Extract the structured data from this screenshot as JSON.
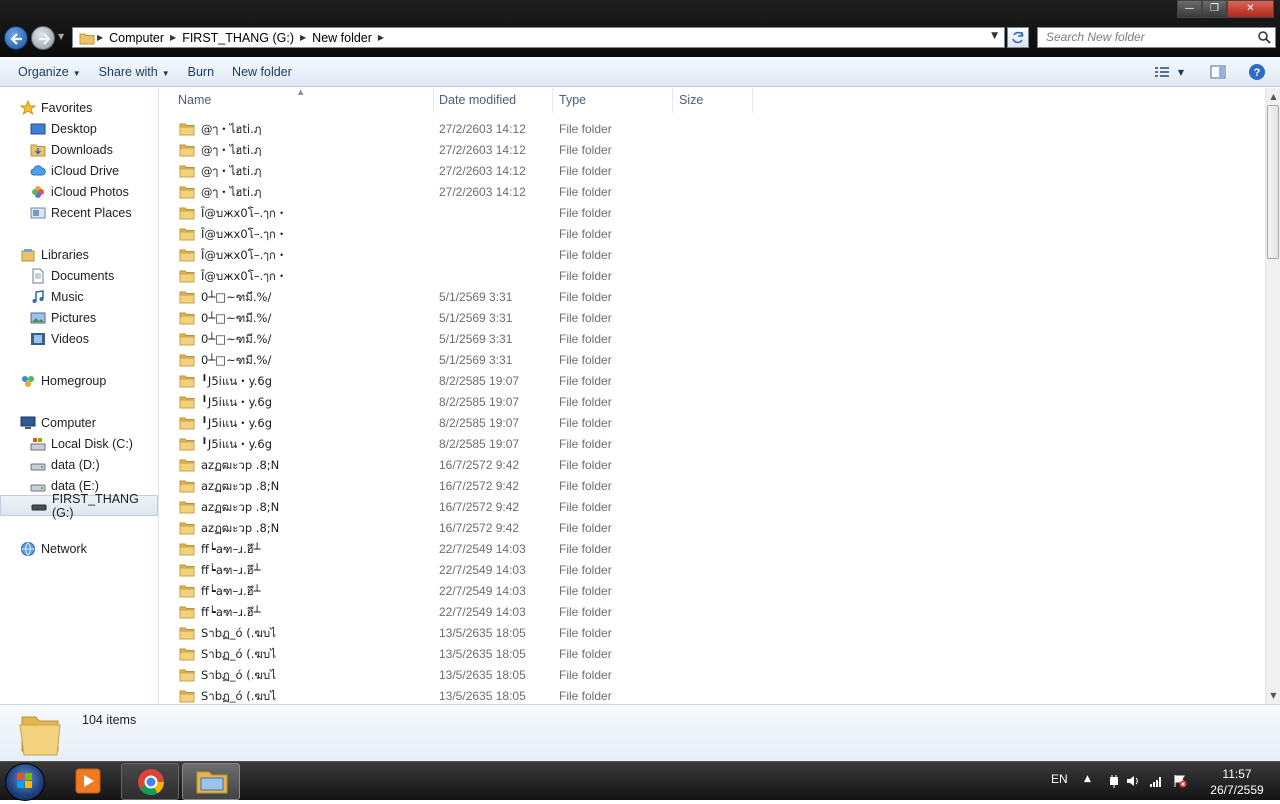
{
  "window": {
    "min_label": "—",
    "max_label": "❐",
    "close_label": "✕"
  },
  "address": {
    "crumbs": [
      "Computer",
      "FIRST_THANG (G:)",
      "New folder"
    ],
    "search_placeholder": "Search New folder"
  },
  "toolbar": {
    "organize": "Organize",
    "share_with": "Share with",
    "burn": "Burn",
    "new_folder": "New folder"
  },
  "nav": {
    "favorites": "Favorites",
    "desktop": "Desktop",
    "downloads": "Downloads",
    "icloud_drive": "iCloud Drive",
    "icloud_photos": "iCloud Photos",
    "recent_places": "Recent Places",
    "libraries": "Libraries",
    "documents": "Documents",
    "music": "Music",
    "pictures": "Pictures",
    "videos": "Videos",
    "homegroup": "Homegroup",
    "computer": "Computer",
    "local_disk": "Local Disk (C:)",
    "data_d": "data (D:)",
    "data_e": "data (E:)",
    "first_thang": "FIRST_THANG (G:)",
    "network": "Network"
  },
  "columns": {
    "name": "Name",
    "date": "Date modified",
    "type": "Type",
    "size": "Size"
  },
  "files": [
    {
      "name": "@ๅ・ไฮti.ฦ",
      "date": "27/2/2603 14:12",
      "type": "File folder",
      "size": ""
    },
    {
      "name": "@ๅ・ไฮti.ฦ",
      "date": "27/2/2603 14:12",
      "type": "File folder",
      "size": ""
    },
    {
      "name": "@ๅ・ไฮti.ฦ",
      "date": "27/2/2603 14:12",
      "type": "File folder",
      "size": ""
    },
    {
      "name": "@ๅ・ไฮti.ฦ",
      "date": "27/2/2603 14:12",
      "type": "File folder",
      "size": ""
    },
    {
      "name": "Ȋ@บжx0โ–.ๅก・",
      "date": "",
      "type": "File folder",
      "size": ""
    },
    {
      "name": "Ȋ@บжx0โ–.ๅก・",
      "date": "",
      "type": "File folder",
      "size": ""
    },
    {
      "name": "Ȋ@บжx0โ–.ๅก・",
      "date": "",
      "type": "File folder",
      "size": ""
    },
    {
      "name": "Ȋ@บжx0โ–.ๅก・",
      "date": "",
      "type": "File folder",
      "size": ""
    },
    {
      "name": "0┴□~ฑมี.%/",
      "date": "5/1/2569 3:31",
      "type": "File folder",
      "size": ""
    },
    {
      "name": "0┴□~ฑมี.%/",
      "date": "5/1/2569 3:31",
      "type": "File folder",
      "size": ""
    },
    {
      "name": "0┴□~ฑมี.%/",
      "date": "5/1/2569 3:31",
      "type": "File folder",
      "size": ""
    },
    {
      "name": "0┴□~ฑมี.%/",
      "date": "5/1/2569 3:31",
      "type": "File folder",
      "size": ""
    },
    {
      "name": "╹J5iแน・y.6g",
      "date": "8/2/2585 19:07",
      "type": "File folder",
      "size": ""
    },
    {
      "name": "╹J5iแน・y.6g",
      "date": "8/2/2585 19:07",
      "type": "File folder",
      "size": ""
    },
    {
      "name": "╹J5iแน・y.6g",
      "date": "8/2/2585 19:07",
      "type": "File folder",
      "size": ""
    },
    {
      "name": "╹J5iแน・y.6g",
      "date": "8/2/2585 19:07",
      "type": "File folder",
      "size": ""
    },
    {
      "name": "azฏฒะวp .8;N",
      "date": "16/7/2572 9:42",
      "type": "File folder",
      "size": ""
    },
    {
      "name": "azฏฒะวp .8;N",
      "date": "16/7/2572 9:42",
      "type": "File folder",
      "size": ""
    },
    {
      "name": "azฏฒะวp .8;N",
      "date": "16/7/2572 9:42",
      "type": "File folder",
      "size": ""
    },
    {
      "name": "azฏฒะวp .8;N",
      "date": "16/7/2572 9:42",
      "type": "File folder",
      "size": ""
    },
    {
      "name": "ff┕aฑ–ɹ.ฮึ┴",
      "date": "22/7/2549 14:03",
      "type": "File folder",
      "size": ""
    },
    {
      "name": "ff┕aฑ–ɹ.ฮึ┴",
      "date": "22/7/2549 14:03",
      "type": "File folder",
      "size": ""
    },
    {
      "name": "ff┕aฑ–ɹ.ฮึ┴",
      "date": "22/7/2549 14:03",
      "type": "File folder",
      "size": ""
    },
    {
      "name": "ff┕aฑ–ɹ.ฮึ┴",
      "date": "22/7/2549 14:03",
      "type": "File folder",
      "size": ""
    },
    {
      "name": "Sาbฏ_ó (.ฆบไ",
      "date": "13/5/2635 18:05",
      "type": "File folder",
      "size": ""
    },
    {
      "name": "Sาbฏ_ó (.ฆบไ",
      "date": "13/5/2635 18:05",
      "type": "File folder",
      "size": ""
    },
    {
      "name": "Sาbฏ_ó (.ฆบไ",
      "date": "13/5/2635 18:05",
      "type": "File folder",
      "size": ""
    },
    {
      "name": "Sาbฏ_ó (.ฆบไ",
      "date": "13/5/2635 18:05",
      "type": "File folder",
      "size": ""
    }
  ],
  "details": {
    "item_count": "104 items"
  },
  "taskbar": {
    "language": "EN",
    "time": "11:57",
    "date": "26/7/2559"
  }
}
